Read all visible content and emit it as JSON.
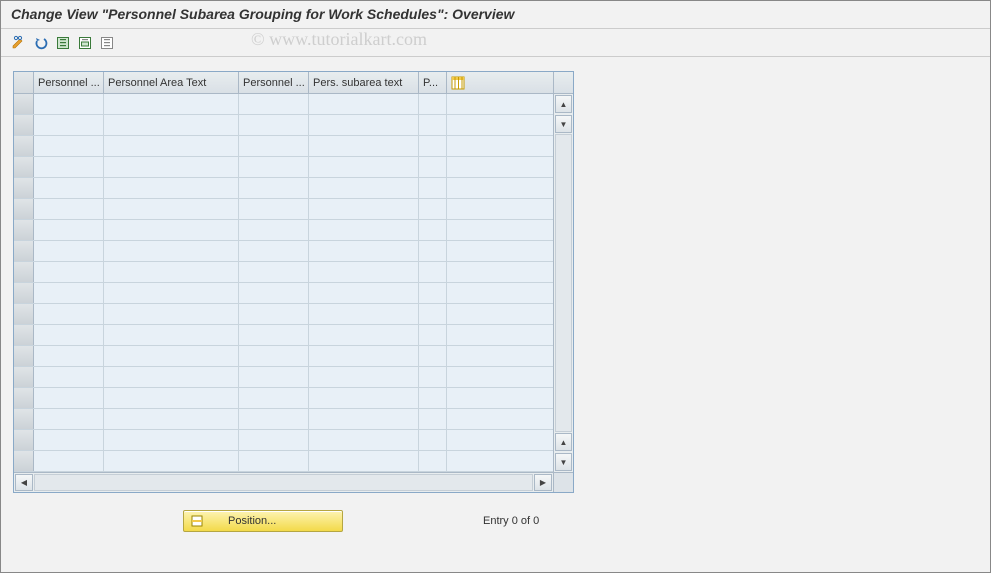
{
  "title": "Change View \"Personnel Subarea Grouping for Work Schedules\": Overview",
  "watermark": "© www.tutorialkart.com",
  "toolbar": {
    "change_display": "Change/Display",
    "undo": "Undo",
    "select_all": "Select All",
    "select_block": "Select Block",
    "deselect_all": "Deselect All"
  },
  "grid": {
    "columns": [
      "Personnel ...",
      "Personnel Area Text",
      "Personnel ...",
      "Pers. subarea text",
      "P..."
    ],
    "config_tooltip": "Configuration",
    "row_count": 18,
    "rows": []
  },
  "footer": {
    "position_label": "Position...",
    "entry_text": "Entry 0 of 0"
  }
}
